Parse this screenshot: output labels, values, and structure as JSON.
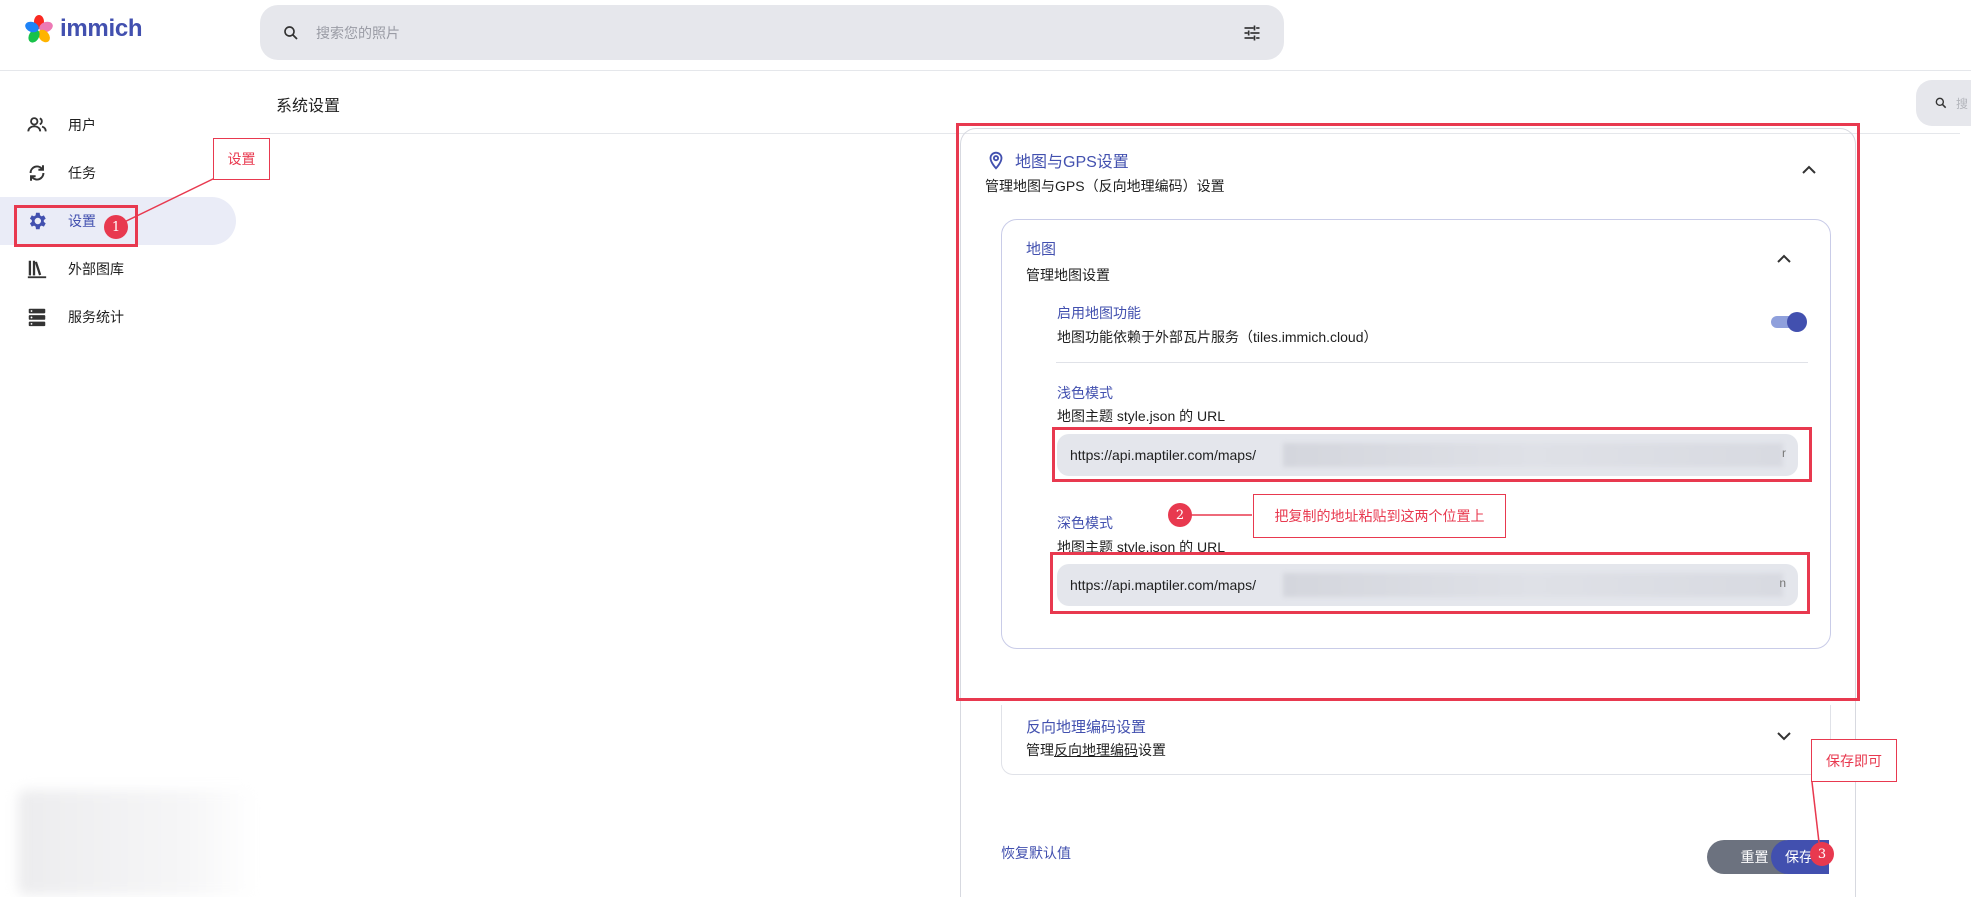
{
  "app": {
    "name": "immich"
  },
  "header": {
    "search_placeholder": "搜索您的照片",
    "icons": [
      "search-icon",
      "tune-icon"
    ]
  },
  "sidebar": {
    "items": [
      {
        "label": "用户",
        "icon": "users-icon"
      },
      {
        "label": "任务",
        "icon": "sync-icon"
      },
      {
        "label": "设置",
        "icon": "gear-icon",
        "active": true
      },
      {
        "label": "外部图库",
        "icon": "library-icon"
      },
      {
        "label": "服务统计",
        "icon": "server-icon"
      }
    ]
  },
  "page": {
    "title": "系统设置",
    "right_search_partial": "搜"
  },
  "settings": {
    "gps": {
      "title": "地图与GPS设置",
      "subtitle": "管理地图与GPS（反向地理编码）设置"
    },
    "map": {
      "title": "地图",
      "subtitle": "管理地图设置",
      "enable": {
        "label": "启用地图功能",
        "description": "地图功能依赖于外部瓦片服务（tiles.immich.cloud）",
        "enabled": true
      },
      "light": {
        "label": "浅色模式",
        "description": "地图主题 style.json 的 URL",
        "value": "https://api.maptiler.com/maps/",
        "tail": "r"
      },
      "dark": {
        "label": "深色模式",
        "description": "地图主题 style.json 的 URL",
        "value": "https://api.maptiler.com/maps/",
        "tail": "n"
      }
    },
    "reverse_geocoding": {
      "title": "反向地理编码设置",
      "subtitle_prefix": "管理",
      "subtitle_link": "反向地理编码",
      "subtitle_suffix": "设置"
    },
    "actions": {
      "restore": "恢复默认值",
      "reset": "重置",
      "save": "保存"
    }
  },
  "annotations": {
    "callout_1": "设置",
    "callout_2": "把复制的地址粘贴到这两个位置上",
    "callout_3": "保存即可",
    "badge_1": "1",
    "badge_2": "2",
    "badge_3": "3",
    "color": "#e8394f"
  }
}
